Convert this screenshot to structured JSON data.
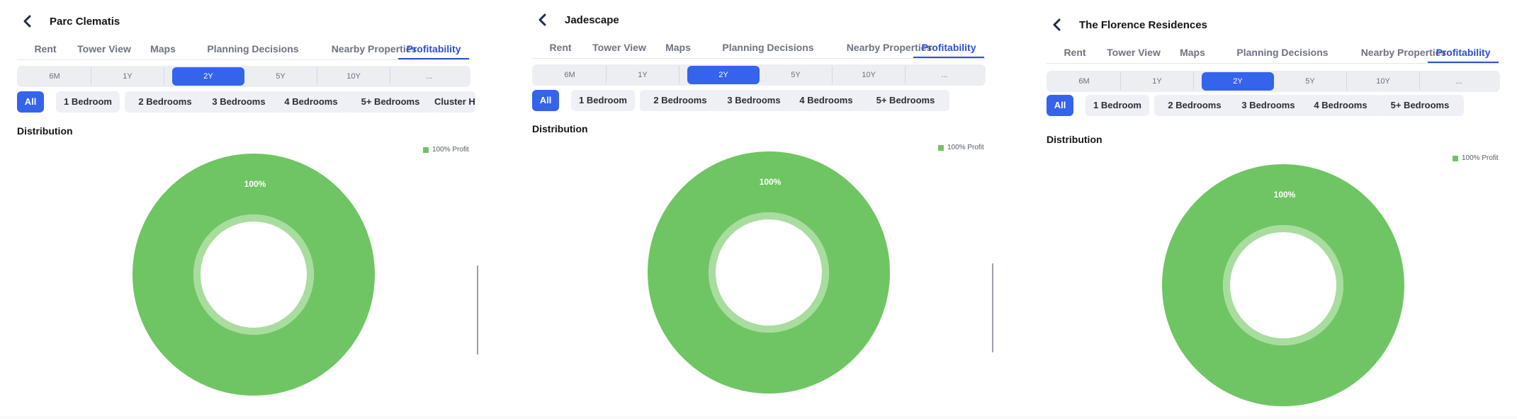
{
  "panels": [
    {
      "title": "Parc Clematis",
      "tabs": [
        "Rent",
        "Tower View",
        "Maps",
        "Planning Decisions",
        "Nearby Properties",
        "Profitability"
      ],
      "active_tab": "Profitability",
      "periods": [
        "6M",
        "1Y",
        "2Y",
        "5Y",
        "10Y",
        "..."
      ],
      "active_period": "2Y",
      "filters": [
        "All",
        "1 Bedroom",
        "2 Bedrooms",
        "3 Bedrooms",
        "4 Bedrooms",
        "5+ Bedrooms",
        "Cluster H"
      ],
      "active_filter": "All",
      "section_title": "Distribution",
      "legend_label": "100% Profit",
      "donut_label": "100%",
      "chart_data": {
        "type": "pie",
        "subtype": "donut",
        "categories": [
          "Profit"
        ],
        "values": [
          100
        ],
        "legend": [
          "100% Profit"
        ],
        "data_labels": [
          "100%"
        ],
        "legend_position": "top-right"
      }
    },
    {
      "title": "Jadescape",
      "tabs": [
        "Rent",
        "Tower View",
        "Maps",
        "Planning Decisions",
        "Nearby Properties",
        "Profitability"
      ],
      "active_tab": "Profitability",
      "periods": [
        "6M",
        "1Y",
        "2Y",
        "5Y",
        "10Y",
        "..."
      ],
      "active_period": "2Y",
      "filters": [
        "All",
        "1 Bedroom",
        "2 Bedrooms",
        "3 Bedrooms",
        "4 Bedrooms",
        "5+ Bedrooms"
      ],
      "active_filter": "All",
      "section_title": "Distribution",
      "legend_label": "100% Profit",
      "donut_label": "100%",
      "chart_data": {
        "type": "pie",
        "subtype": "donut",
        "categories": [
          "Profit"
        ],
        "values": [
          100
        ],
        "legend": [
          "100% Profit"
        ],
        "data_labels": [
          "100%"
        ],
        "legend_position": "top-right"
      }
    },
    {
      "title": "The Florence Residences",
      "tabs": [
        "Rent",
        "Tower View",
        "Maps",
        "Planning Decisions",
        "Nearby Properties",
        "Profitability"
      ],
      "active_tab": "Profitability",
      "periods": [
        "6M",
        "1Y",
        "2Y",
        "5Y",
        "10Y",
        "..."
      ],
      "active_period": "2Y",
      "filters": [
        "All",
        "1 Bedroom",
        "2 Bedrooms",
        "3 Bedrooms",
        "4 Bedrooms",
        "5+ Bedrooms"
      ],
      "active_filter": "All",
      "section_title": "Distribution",
      "legend_label": "100% Profit",
      "donut_label": "100%",
      "chart_data": {
        "type": "pie",
        "subtype": "donut",
        "categories": [
          "Profit"
        ],
        "values": [
          100
        ],
        "legend": [
          "100% Profit"
        ],
        "data_labels": [
          "100%"
        ],
        "legend_position": "top-right"
      }
    }
  ],
  "colors": {
    "accent": "#3563ec",
    "active_tab_text": "#2e4fd6",
    "profit_green": "#6fc563",
    "donut_inner_ring": "#a9dc9f",
    "chip_background": "#eef0f5",
    "segment_background": "#eceef2"
  },
  "icons": {
    "back": "chevron-left-icon"
  }
}
